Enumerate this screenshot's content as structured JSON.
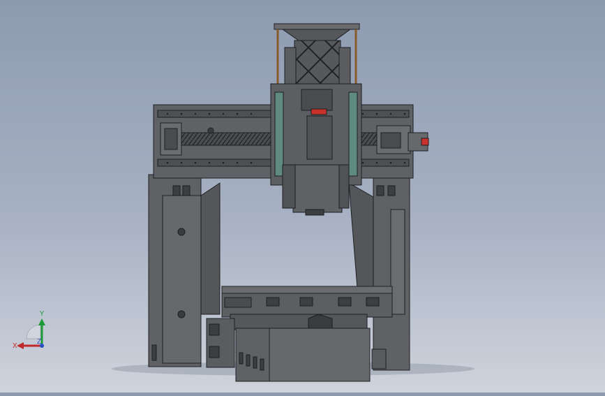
{
  "viewport": {
    "background_top": "#8d9ab0",
    "background_bottom": "#cfd3db"
  },
  "model": {
    "body_color": "#5f6165",
    "edge_color": "#1e1f22",
    "accent_red": "#c8322a",
    "accent_teal": "#5e8a80",
    "rod_color": "#8a5a2a"
  },
  "triad": {
    "x_label": "X",
    "y_label": "Y",
    "z_label": "Z",
    "x_color": "#c0282a",
    "y_color": "#1f9a3a",
    "z_color": "#2a4fc0"
  }
}
